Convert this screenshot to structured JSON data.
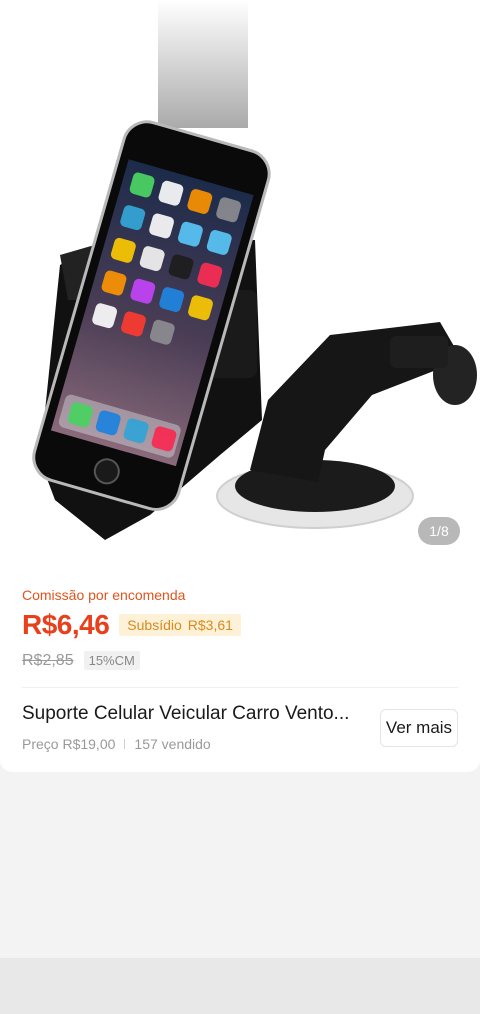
{
  "gallery": {
    "page_indicator": "1/8",
    "image": "product-photo-car-phone-holder"
  },
  "offer": {
    "commission_label": "Comissão por encomenda",
    "commission_price": "R$6,46",
    "subsidy_label": "Subsídio",
    "subsidy_value": "R$3,61",
    "old_price": "R$2,85",
    "commission_rate": "15%CM"
  },
  "product": {
    "title": "Suporte Celular Veicular Carro Vento...",
    "price_label": "Preço R$19,00",
    "sold_count": "157 vendido",
    "see_more_label": "Ver mais"
  },
  "colors": {
    "accent_orange": "#e8401c",
    "subsidy_bg": "#fdf1d8",
    "subsidy_text": "#d98a1a"
  }
}
